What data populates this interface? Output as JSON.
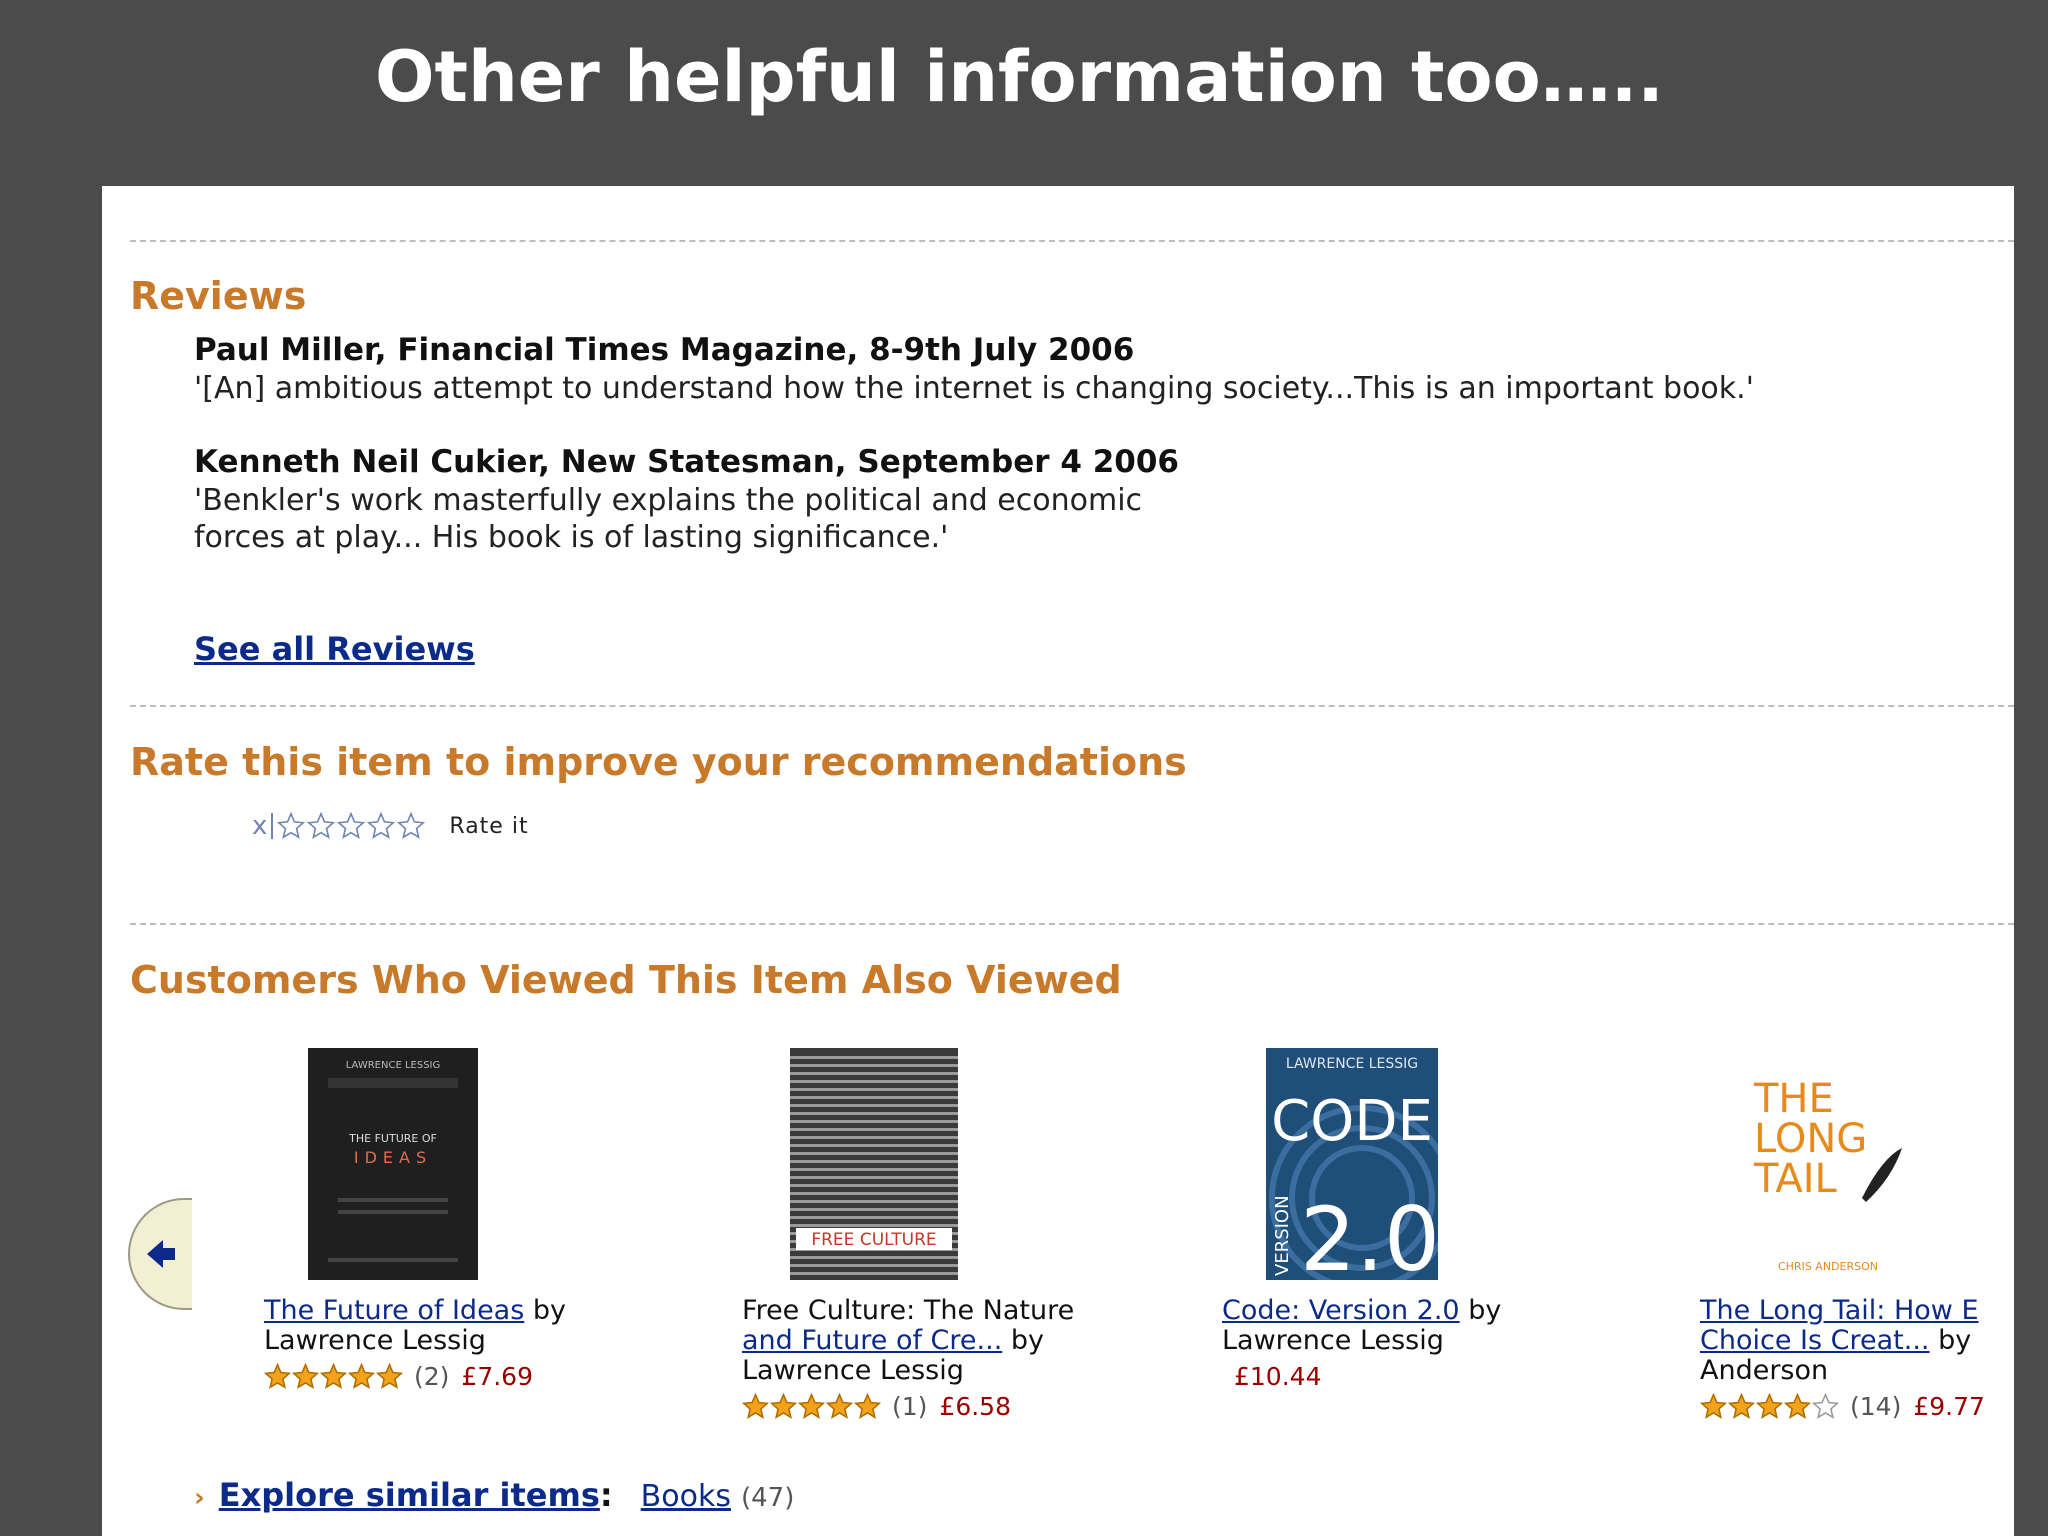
{
  "slide_title": "Other helpful information too…..",
  "reviews": {
    "heading": "Reviews",
    "items": [
      {
        "name": "Paul Miller, Financial Times Magazine, 8-9th July 2006",
        "lines": [
          "'[An] ambitious attempt to understand how the internet is changing society...This is an important book.'"
        ]
      },
      {
        "name": "Kenneth Neil Cukier, New Statesman, September 4 2006",
        "lines": [
          "'Benkler's work masterfully explains the political and economic",
          "forces at play... His book is of lasting significance.'"
        ]
      }
    ],
    "see_all": "See all Reviews"
  },
  "rate": {
    "heading": "Rate this item to improve your recommendations",
    "clear_label": "x",
    "label": "Rate it"
  },
  "also_viewed": {
    "heading": "Customers Who Viewed This Item Also Viewed",
    "items": [
      {
        "title_line1": "The Future of Ideas",
        "title_line2": "",
        "by": "by",
        "author": "Lawrence Lessig",
        "rating": 5,
        "count": "(2)",
        "price": "£7.69",
        "cover": {
          "author": "LAWRENCE LESSIG",
          "title1": "THE FUTURE OF",
          "title2": "IDEAS",
          "bg": "#1f1f1f"
        }
      },
      {
        "title_line1": "Free Culture: The Nature",
        "title_line2": "and Future of Cre...",
        "by": "by",
        "author": "Lawrence Lessig",
        "rating": 5,
        "count": "(1)",
        "price": "£6.58",
        "cover": {
          "title1": "FREE CULTURE",
          "bg": "#3a3a3a"
        }
      },
      {
        "title_line1": "Code: Version 2.0",
        "title_line2": "",
        "by": "by",
        "author": "Lawrence Lessig",
        "rating": 0,
        "count": "",
        "price": "£10.44",
        "cover": {
          "author": "LAWRENCE LESSIG",
          "title1": "CODE",
          "title2": "2.0",
          "side": "VERSION",
          "bg": "#1f4e79"
        }
      },
      {
        "title_line1": "The Long Tail: How E",
        "title_line2": "Choice Is Creat...",
        "by": "by",
        "author": "Anderson",
        "rating": 4,
        "count": "(14)",
        "price": "£9.77",
        "cover": {
          "title1": "THE",
          "title2": "LONG",
          "title3": "TAIL",
          "author": "CHRIS ANDERSON",
          "bg": "#ffffff"
        }
      }
    ]
  },
  "explore": {
    "link": "Explore similar items",
    "colon": ":",
    "category": "Books",
    "count": "(47)"
  },
  "colors": {
    "heading": "#c87a2a",
    "link": "#0b2a8a",
    "price": "#990000",
    "star": "#f2a21b",
    "background": "#4b4b4b"
  }
}
